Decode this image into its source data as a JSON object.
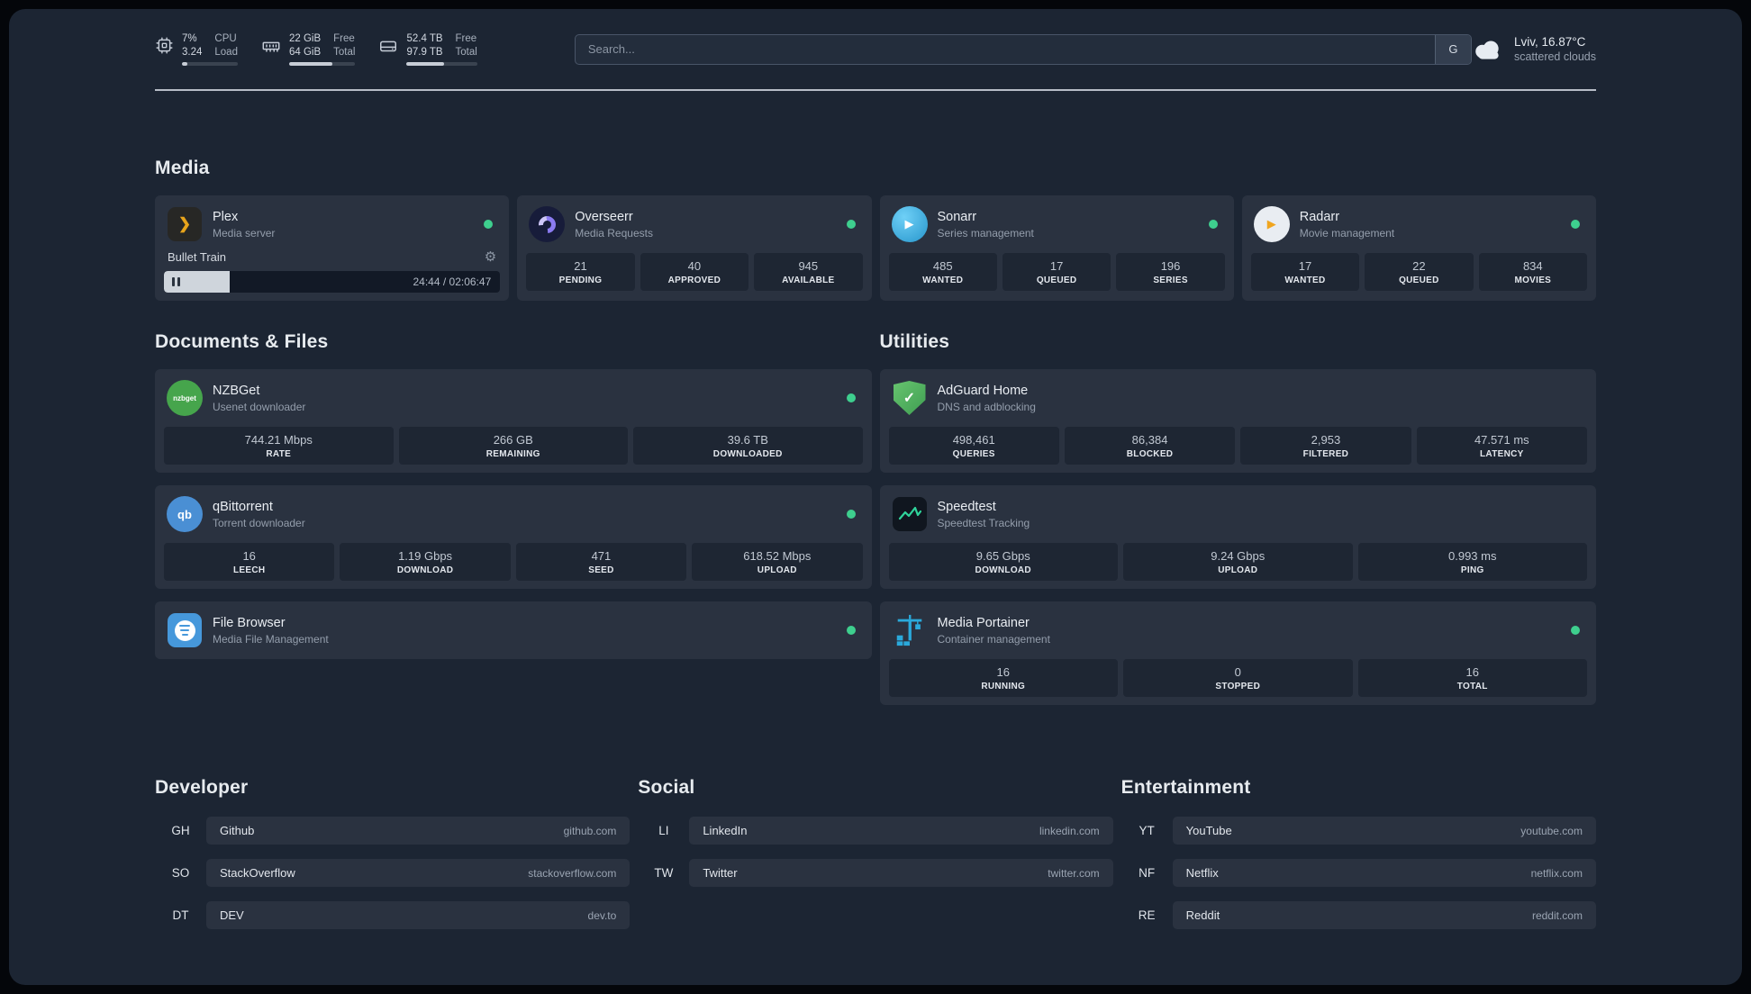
{
  "colors": {
    "background": "#1c2533",
    "card": "#2a3240",
    "stat_box": "#1e2633",
    "status_online": "#3ecf8e",
    "accent_green": "#2fd49b",
    "progress_fill": "#cfd5dc"
  },
  "icons": {
    "gear": "⚙",
    "play": "▶",
    "check": "✓",
    "plex_chevron": "❯",
    "qb_text": "qb",
    "nzbget_text": "nzbget"
  },
  "topbar": {
    "cpu": {
      "value1": "7%",
      "label1": "CPU",
      "value2": "3.24",
      "label2": "Load"
    },
    "memory": {
      "value1": "22 GiB",
      "label1": "Free",
      "value2": "64 GiB",
      "label2": "Total"
    },
    "disk": {
      "value1": "52.4 TB",
      "label1": "Free",
      "value2": "97.9 TB",
      "label2": "Total"
    },
    "search": {
      "placeholder": "Search...",
      "button": "G"
    },
    "weather": {
      "location": "Lviv, 16.87°C",
      "condition": "scattered clouds"
    }
  },
  "sections": {
    "media": {
      "title": "Media"
    },
    "documents": {
      "title": "Documents & Files"
    },
    "utilities": {
      "title": "Utilities"
    },
    "developer": {
      "title": "Developer"
    },
    "social": {
      "title": "Social"
    },
    "entertainment": {
      "title": "Entertainment"
    }
  },
  "services": {
    "plex": {
      "name": "Plex",
      "subtitle": "Media server",
      "now_playing": "Bullet Train",
      "time": "24:44 / 02:06:47"
    },
    "overseerr": {
      "name": "Overseerr",
      "subtitle": "Media Requests",
      "stats": [
        {
          "value": "21",
          "label": "PENDING"
        },
        {
          "value": "40",
          "label": "APPROVED"
        },
        {
          "value": "945",
          "label": "AVAILABLE"
        }
      ]
    },
    "sonarr": {
      "name": "Sonarr",
      "subtitle": "Series management",
      "stats": [
        {
          "value": "485",
          "label": "WANTED"
        },
        {
          "value": "17",
          "label": "QUEUED"
        },
        {
          "value": "196",
          "label": "SERIES"
        }
      ]
    },
    "radarr": {
      "name": "Radarr",
      "subtitle": "Movie management",
      "stats": [
        {
          "value": "17",
          "label": "WANTED"
        },
        {
          "value": "22",
          "label": "QUEUED"
        },
        {
          "value": "834",
          "label": "MOVIES"
        }
      ]
    },
    "nzbget": {
      "name": "NZBGet",
      "subtitle": "Usenet downloader",
      "stats": [
        {
          "value": "744.21 Mbps",
          "label": "RATE"
        },
        {
          "value": "266 GB",
          "label": "REMAINING"
        },
        {
          "value": "39.6 TB",
          "label": "DOWNLOADED"
        }
      ]
    },
    "qbittorrent": {
      "name": "qBittorrent",
      "subtitle": "Torrent downloader",
      "stats": [
        {
          "value": "16",
          "label": "LEECH"
        },
        {
          "value": "1.19 Gbps",
          "label": "DOWNLOAD"
        },
        {
          "value": "471",
          "label": "SEED"
        },
        {
          "value": "618.52 Mbps",
          "label": "UPLOAD"
        }
      ]
    },
    "filebrowser": {
      "name": "File Browser",
      "subtitle": "Media File Management"
    },
    "adguard": {
      "name": "AdGuard Home",
      "subtitle": "DNS and adblocking",
      "stats": [
        {
          "value": "498,461",
          "label": "QUERIES"
        },
        {
          "value": "86,384",
          "label": "BLOCKED"
        },
        {
          "value": "2,953",
          "label": "FILTERED"
        },
        {
          "value": "47.571 ms",
          "label": "LATENCY"
        }
      ]
    },
    "speedtest": {
      "name": "Speedtest",
      "subtitle": "Speedtest Tracking",
      "stats": [
        {
          "value": "9.65 Gbps",
          "label": "DOWNLOAD"
        },
        {
          "value": "9.24 Gbps",
          "label": "UPLOAD"
        },
        {
          "value": "0.993 ms",
          "label": "PING"
        }
      ]
    },
    "portainer": {
      "name": "Media Portainer",
      "subtitle": "Container management",
      "stats": [
        {
          "value": "16",
          "label": "RUNNING"
        },
        {
          "value": "0",
          "label": "STOPPED"
        },
        {
          "value": "16",
          "label": "TOTAL"
        }
      ]
    }
  },
  "bookmarks": {
    "developer": [
      {
        "abbr": "GH",
        "name": "Github",
        "url": "github.com"
      },
      {
        "abbr": "SO",
        "name": "StackOverflow",
        "url": "stackoverflow.com"
      },
      {
        "abbr": "DT",
        "name": "DEV",
        "url": "dev.to"
      }
    ],
    "social": [
      {
        "abbr": "LI",
        "name": "LinkedIn",
        "url": "linkedin.com"
      },
      {
        "abbr": "TW",
        "name": "Twitter",
        "url": "twitter.com"
      }
    ],
    "entertainment": [
      {
        "abbr": "YT",
        "name": "YouTube",
        "url": "youtube.com"
      },
      {
        "abbr": "NF",
        "name": "Netflix",
        "url": "netflix.com"
      },
      {
        "abbr": "RE",
        "name": "Reddit",
        "url": "reddit.com"
      }
    ]
  }
}
